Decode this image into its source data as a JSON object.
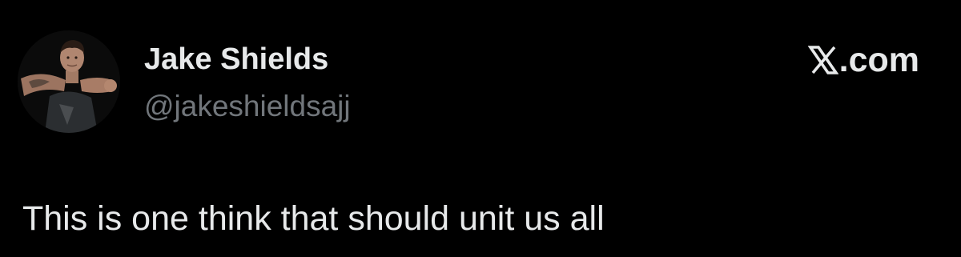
{
  "author": {
    "display_name": "Jake Shields",
    "handle": "@jakeshieldsajj",
    "avatar_icon": "profile-photo"
  },
  "brand": {
    "icon": "x-logo-icon",
    "suffix": ".com"
  },
  "tweet": {
    "text": "This is one think that should unit us all"
  },
  "colors": {
    "background": "#000000",
    "primary_text": "#e7e9ea",
    "secondary_text": "#71767b"
  }
}
